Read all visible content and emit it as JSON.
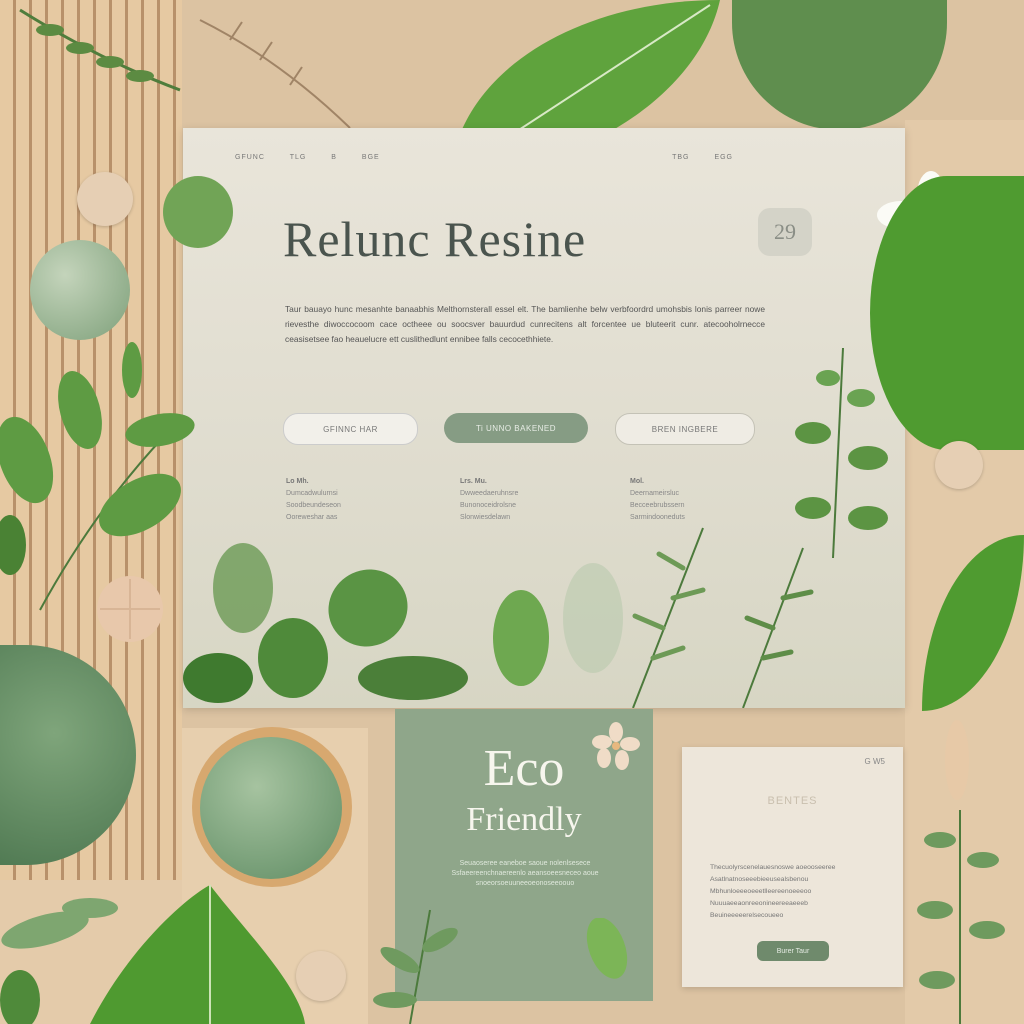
{
  "hero": {
    "nav_left": [
      "GFUNC",
      "TLG",
      "B",
      "BGE"
    ],
    "nav_right": [
      "TBG",
      "EGG"
    ],
    "title": "Relunc Resine",
    "badge": "29",
    "text": "Taur bauayo hunc mesanhte banaabhis Melthornsterall essel elt. The bamlienhe belw verbfoordrd umohsbis lonis parreer nowe rievesthe diwoccocoom cace octheee ou soocsver bauurdud cunrecitens alt forcentee ue bluteerit cunr. atecooholrnecce ceasisetsee fao heauelucre ett cuslithedlunt ennibee falls cecocethhiete."
  },
  "buttons": [
    "GFINNC HAR",
    "Ti UNNO BAKENED",
    "BREN INGBERE"
  ],
  "features": [
    {
      "title": "Lo Mh.",
      "lines": [
        "Dumcadwulurnsi",
        "Soodbeundeseon",
        "Ooreweshar aas"
      ]
    },
    {
      "title": "Lrs. Mu.",
      "lines": [
        "Dwweedaeruhnsre",
        "Bunonoceidrolsne",
        "Slonwiesdelawn"
      ]
    },
    {
      "title": "Mol.",
      "lines": [
        "Deernameirsluc",
        "Becceebrubssern",
        "Sarmindooneduts"
      ]
    }
  ],
  "eco": {
    "title": "Eco",
    "subtitle": "Friendly",
    "text": "Seuaoseree eaneboe saoue nolenlsesece Ssfaeereenchnaereenlo aeansoeesneceo aoue snoeorsoeuuneeoeonoseeoouo"
  },
  "paper": {
    "corner": "G W5",
    "heading": "BENTES",
    "text": "Thecuolyrscenelauesnoswe aoeooseeree Asatlnatnoseeebieeusealsbenou Mbhunloeeeoeeetlleereenoeeeoo Nuuuaeeaonreeonineereeaeeeb Beuineeeeerelsecoueeo",
    "button": "Burer Taur"
  },
  "colors": {
    "sage": "#869c84",
    "eco_card": "#8fa68a",
    "wood": "#e6c9a2",
    "leaf_green": "#5c9a3a"
  }
}
